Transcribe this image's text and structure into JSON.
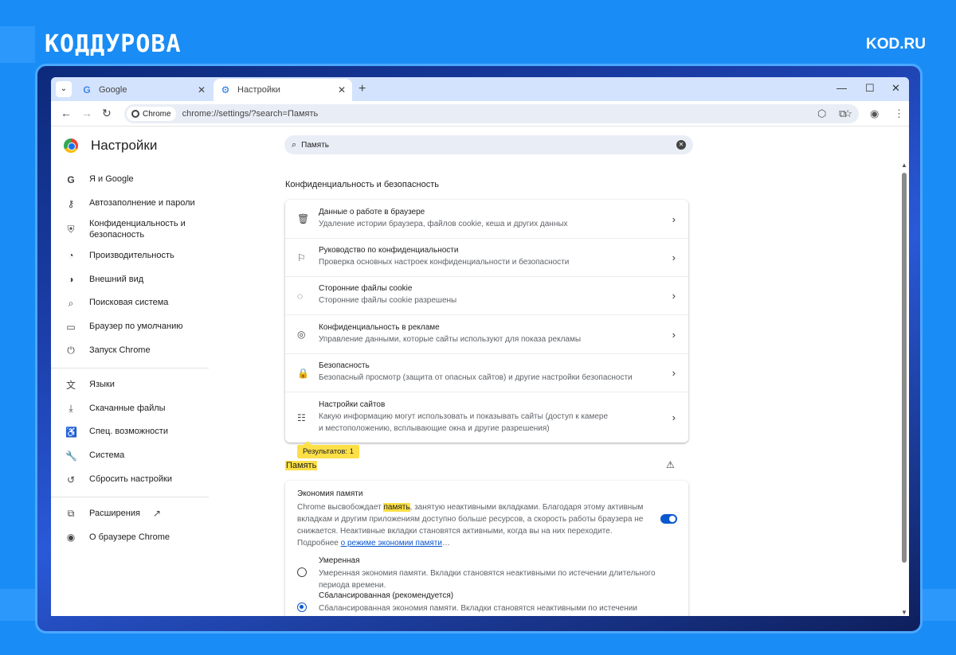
{
  "brand": {
    "logo": "КОДДУРОВА",
    "site": "KOD.RU"
  },
  "tabs": [
    {
      "label": "Google",
      "icon": "google-icon"
    },
    {
      "label": "Настройки",
      "icon": "gear-icon"
    }
  ],
  "toolbar": {
    "chip_label": "Chrome",
    "url": "chrome://settings/?search=Память"
  },
  "sidebar": {
    "title": "Настройки",
    "items": [
      {
        "label": "Я и Google",
        "icon": "G"
      },
      {
        "label": "Автозаполнение и пароли",
        "icon": "⚷"
      },
      {
        "label": "Конфиденциальность и безопасность",
        "icon": "⛨"
      },
      {
        "label": "Производительность",
        "icon": "◔"
      },
      {
        "label": "Внешний вид",
        "icon": "◑"
      },
      {
        "label": "Поисковая система",
        "icon": "⌕"
      },
      {
        "label": "Браузер по умолчанию",
        "icon": "▭"
      },
      {
        "label": "Запуск Chrome",
        "icon": "⏻"
      },
      {
        "label": "Языки",
        "icon": "文"
      },
      {
        "label": "Скачанные файлы",
        "icon": "⤓"
      },
      {
        "label": "Спец. возможности",
        "icon": "♿"
      },
      {
        "label": "Система",
        "icon": "🔧"
      },
      {
        "label": "Сбросить настройки",
        "icon": "↺"
      },
      {
        "label": "Расширения",
        "icon": "⧉"
      },
      {
        "label": "О браузере Chrome",
        "icon": "◉"
      }
    ]
  },
  "search": {
    "value": "Память"
  },
  "privacy": {
    "title": "Конфиденциальность и безопасность",
    "rows": [
      {
        "title": "Данные о работе в браузере",
        "sub": "Удаление истории браузера, файлов cookie, кеша и других данных"
      },
      {
        "title": "Руководство по конфиденциальности",
        "sub": "Проверка основных настроек конфиденциальности и безопасности"
      },
      {
        "title": "Сторонние файлы cookie",
        "sub": "Сторонние файлы cookie разрешены"
      },
      {
        "title": "Конфиденциальность в рекламе",
        "sub": "Управление данными, которые сайты используют для показа рекламы"
      },
      {
        "title": "Безопасность",
        "sub": "Безопасный просмотр (защита от опасных сайтов) и другие настройки безопасности"
      },
      {
        "title": "Настройки сайтов",
        "sub": "Какую информацию могут использовать и показывать сайты (доступ к камере и местоположению, всплывающие окна и другие разрешения)"
      }
    ]
  },
  "results_badge": "Результатов: 1",
  "memory": {
    "section_title": "Память",
    "card_title": "Экономия памяти",
    "desc_before": "Chrome высвобождает ",
    "desc_highlight": "память",
    "desc_after": ", занятую неактивными вкладками. Благодаря этому активным вкладкам и другим приложениям доступно больше ресурсов, а скорость работы браузера не снижается. Неактивные вкладки становятся активными, когда вы на них переходите. Подробнее ",
    "desc_link": "о режиме экономии памяти",
    "desc_ellipsis": "…",
    "toggle_on": true,
    "options": [
      {
        "title": "Умеренная",
        "sub": "Умеренная экономия памяти. Вкладки становятся неактивными по истечении длительного периода времени.",
        "selected": false
      },
      {
        "title": "Сбалансированная (рекомендуется)",
        "sub": "Сбалансированная экономия памяти. Вкладки становятся неактивными по истечении оптимального",
        "selected": true
      }
    ]
  }
}
